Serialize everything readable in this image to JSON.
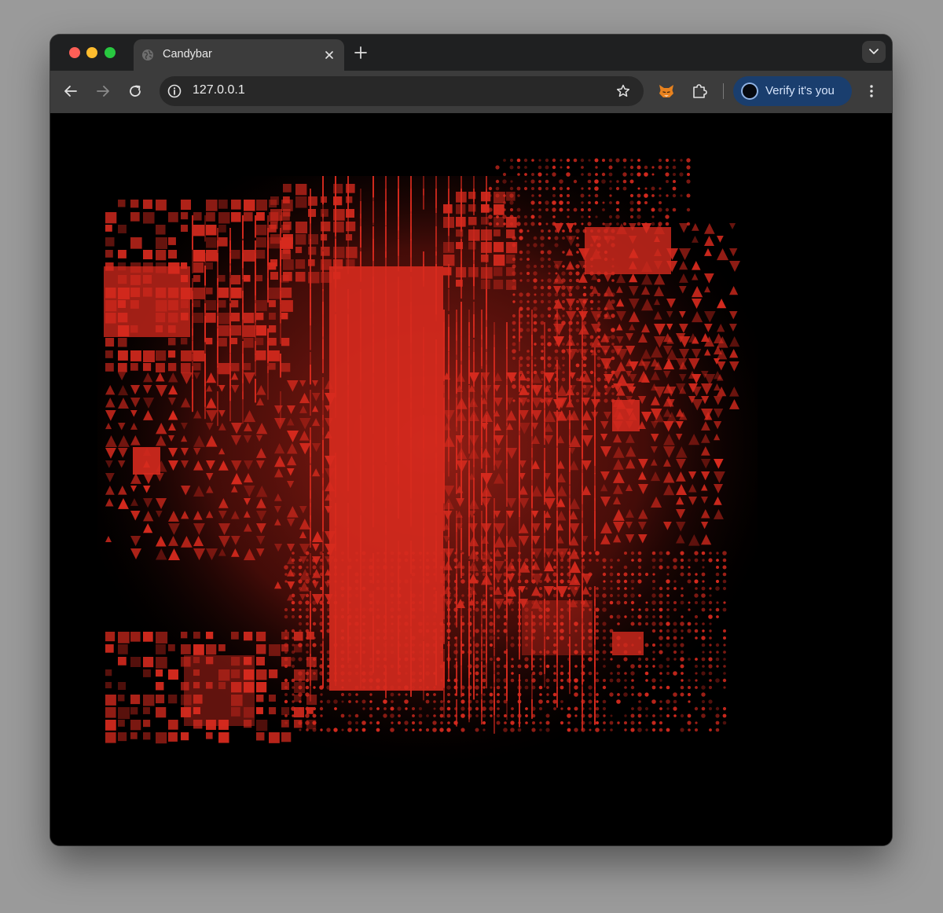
{
  "tab": {
    "title": "Candybar",
    "favicon_icon": "globe-icon",
    "close_icon": "close-icon"
  },
  "toolbar": {
    "back_icon": "arrow-left-icon",
    "forward_icon": "arrow-right-icon",
    "reload_icon": "reload-icon",
    "new_tab_icon": "plus-icon",
    "tab_search_icon": "chevron-down-icon",
    "extension_fox_icon": "fox-icon",
    "extensions_icon": "puzzle-icon",
    "menu_icon": "kebab-menu-icon"
  },
  "omnibox": {
    "url": "127.0.0.1",
    "info_icon": "info-icon",
    "bookmark_icon": "star-icon"
  },
  "profile": {
    "label": "Verify it's you"
  },
  "canvas": {
    "background": "#000000",
    "accent": "#d62a1e"
  }
}
